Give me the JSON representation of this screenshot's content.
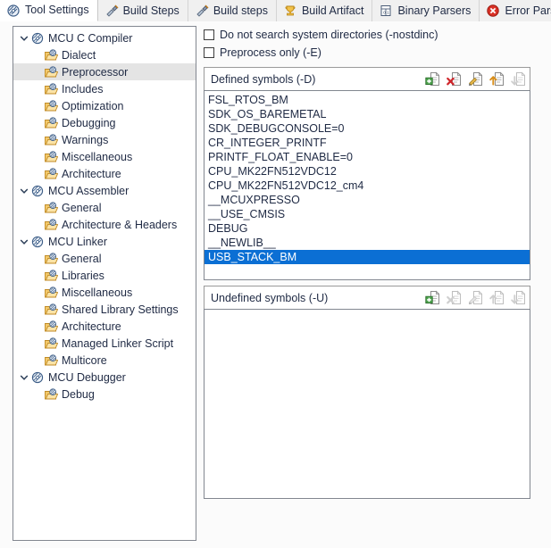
{
  "tabs": [
    {
      "label": "Tool Settings",
      "icon": "tool-settings-icon",
      "active": true
    },
    {
      "label": "Build Steps",
      "icon": "build-steps-icon",
      "active": false
    },
    {
      "label": "Build steps",
      "icon": "build-steps-icon",
      "active": false
    },
    {
      "label": "Build Artifact",
      "icon": "build-artifact-icon",
      "active": false
    },
    {
      "label": "Binary Parsers",
      "icon": "binary-parsers-icon",
      "active": false
    },
    {
      "label": "Error Parsers",
      "icon": "error-parsers-icon",
      "active": false
    }
  ],
  "tree": [
    {
      "label": "MCU C Compiler",
      "level": 0,
      "expanded": true,
      "selected": false,
      "icon": "tool-node-icon"
    },
    {
      "label": "Dialect",
      "level": 1,
      "expanded": null,
      "selected": false,
      "icon": "settings-page-icon"
    },
    {
      "label": "Preprocessor",
      "level": 1,
      "expanded": null,
      "selected": true,
      "icon": "settings-page-icon"
    },
    {
      "label": "Includes",
      "level": 1,
      "expanded": null,
      "selected": false,
      "icon": "settings-page-icon"
    },
    {
      "label": "Optimization",
      "level": 1,
      "expanded": null,
      "selected": false,
      "icon": "settings-page-icon"
    },
    {
      "label": "Debugging",
      "level": 1,
      "expanded": null,
      "selected": false,
      "icon": "settings-page-icon"
    },
    {
      "label": "Warnings",
      "level": 1,
      "expanded": null,
      "selected": false,
      "icon": "settings-page-icon"
    },
    {
      "label": "Miscellaneous",
      "level": 1,
      "expanded": null,
      "selected": false,
      "icon": "settings-page-icon"
    },
    {
      "label": "Architecture",
      "level": 1,
      "expanded": null,
      "selected": false,
      "icon": "settings-page-icon"
    },
    {
      "label": "MCU Assembler",
      "level": 0,
      "expanded": true,
      "selected": false,
      "icon": "tool-node-icon"
    },
    {
      "label": "General",
      "level": 1,
      "expanded": null,
      "selected": false,
      "icon": "settings-page-icon"
    },
    {
      "label": "Architecture & Headers",
      "level": 1,
      "expanded": null,
      "selected": false,
      "icon": "settings-page-icon"
    },
    {
      "label": "MCU Linker",
      "level": 0,
      "expanded": true,
      "selected": false,
      "icon": "tool-node-icon"
    },
    {
      "label": "General",
      "level": 1,
      "expanded": null,
      "selected": false,
      "icon": "settings-page-icon"
    },
    {
      "label": "Libraries",
      "level": 1,
      "expanded": null,
      "selected": false,
      "icon": "settings-page-icon"
    },
    {
      "label": "Miscellaneous",
      "level": 1,
      "expanded": null,
      "selected": false,
      "icon": "settings-page-icon"
    },
    {
      "label": "Shared Library Settings",
      "level": 1,
      "expanded": null,
      "selected": false,
      "icon": "settings-page-icon"
    },
    {
      "label": "Architecture",
      "level": 1,
      "expanded": null,
      "selected": false,
      "icon": "settings-page-icon"
    },
    {
      "label": "Managed Linker Script",
      "level": 1,
      "expanded": null,
      "selected": false,
      "icon": "settings-page-icon"
    },
    {
      "label": "Multicore",
      "level": 1,
      "expanded": null,
      "selected": false,
      "icon": "settings-page-icon"
    },
    {
      "label": "MCU Debugger",
      "level": 0,
      "expanded": true,
      "selected": false,
      "icon": "tool-node-icon"
    },
    {
      "label": "Debug",
      "level": 1,
      "expanded": null,
      "selected": false,
      "icon": "settings-page-icon"
    }
  ],
  "options": [
    {
      "label": "Do not search system directories (-nostdinc)",
      "checked": false,
      "name": "nostdinc"
    },
    {
      "label": "Preprocess only (-E)",
      "checked": false,
      "name": "preprocess-only"
    }
  ],
  "defined_symbols": {
    "title": "Defined symbols (-D)",
    "tools": [
      {
        "name": "add-icon",
        "enabled": true
      },
      {
        "name": "delete-icon",
        "enabled": true
      },
      {
        "name": "edit-icon",
        "enabled": true
      },
      {
        "name": "move-up-icon",
        "enabled": true
      },
      {
        "name": "move-down-icon",
        "enabled": false
      }
    ],
    "items": [
      {
        "label": "FSL_RTOS_BM",
        "selected": false
      },
      {
        "label": "SDK_OS_BAREMETAL",
        "selected": false
      },
      {
        "label": "SDK_DEBUGCONSOLE=0",
        "selected": false
      },
      {
        "label": "CR_INTEGER_PRINTF",
        "selected": false
      },
      {
        "label": "PRINTF_FLOAT_ENABLE=0",
        "selected": false
      },
      {
        "label": "CPU_MK22FN512VDC12",
        "selected": false
      },
      {
        "label": "CPU_MK22FN512VDC12_cm4",
        "selected": false
      },
      {
        "label": "__MCUXPRESSO",
        "selected": false
      },
      {
        "label": "__USE_CMSIS",
        "selected": false
      },
      {
        "label": "DEBUG",
        "selected": false
      },
      {
        "label": "__NEWLIB__",
        "selected": false
      },
      {
        "label": "USB_STACK_BM",
        "selected": true
      }
    ]
  },
  "undefined_symbols": {
    "title": "Undefined symbols (-U)",
    "tools": [
      {
        "name": "add-icon",
        "enabled": true
      },
      {
        "name": "delete-icon",
        "enabled": false
      },
      {
        "name": "edit-icon",
        "enabled": false
      },
      {
        "name": "move-up-icon",
        "enabled": false
      },
      {
        "name": "move-down-icon",
        "enabled": false
      }
    ],
    "items": []
  },
  "colors": {
    "selection_blue": "#0b6fd4",
    "tree_selection_grey": "#e4e4e4",
    "text": "#1f2a44",
    "panel_border": "#828790",
    "folder_yellow": "#f0c060"
  }
}
